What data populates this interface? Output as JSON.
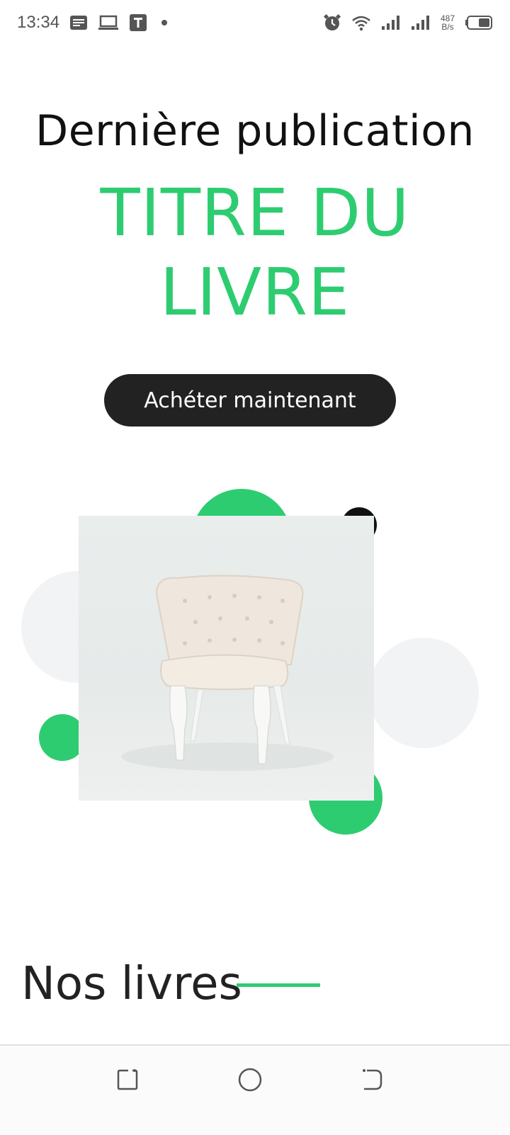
{
  "status_bar": {
    "time": "13:34",
    "net_speed_value": "487",
    "net_speed_unit": "B/s",
    "icons_left": [
      "message-icon",
      "laptop-icon",
      "t-app-icon",
      "dot-icon"
    ],
    "icons_right": [
      "alarm-icon",
      "wifi-icon",
      "signal-icon",
      "signal-icon",
      "battery-icon"
    ]
  },
  "hero": {
    "subtitle": "Dernière publication",
    "title_line1": "TITRE DU",
    "title_line2": "LIVRE",
    "buy_label": "Achéter maintenant"
  },
  "image": {
    "subject": "chair-photo"
  },
  "section": {
    "title": "Nos livres"
  },
  "nav_bar": {
    "buttons": [
      "recents-icon",
      "home-icon",
      "back-icon"
    ]
  },
  "colors": {
    "accent": "#2ecc71",
    "button_bg": "#222222",
    "gray_circle": "#f1f3f5"
  }
}
